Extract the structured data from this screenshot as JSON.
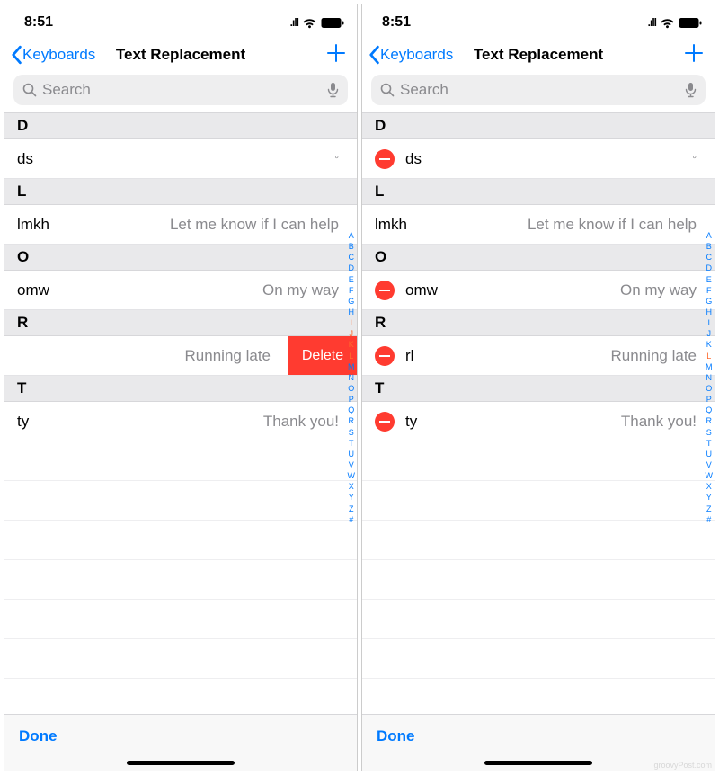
{
  "status": {
    "time": "8:51"
  },
  "nav": {
    "back": "Keyboards",
    "title": "Text Replacement"
  },
  "search": {
    "placeholder": "Search"
  },
  "sections": {
    "d": "D",
    "l": "L",
    "o": "O",
    "r": "R",
    "t": "T"
  },
  "rows": {
    "ds": {
      "shortcut": "ds",
      "phrase": "°"
    },
    "lmkh": {
      "shortcut": "lmkh",
      "phrase": "Let me know if I can help"
    },
    "omw": {
      "shortcut": "omw",
      "phrase": "On my way"
    },
    "rl": {
      "shortcut": "rl",
      "phrase": "Running late"
    },
    "ty": {
      "shortcut": "ty",
      "phrase": "Thank you!"
    }
  },
  "actions": {
    "delete": "Delete",
    "done": "Done"
  },
  "index": [
    "A",
    "B",
    "C",
    "D",
    "E",
    "F",
    "G",
    "H",
    "I",
    "J",
    "K",
    "L",
    "M",
    "N",
    "O",
    "P",
    "Q",
    "R",
    "S",
    "T",
    "U",
    "V",
    "W",
    "X",
    "Y",
    "Z",
    "#"
  ],
  "index_hi_left": [
    "I",
    "J",
    "K",
    "L"
  ],
  "index_hi_right": [
    "L"
  ],
  "watermark": "groovyPost.com"
}
